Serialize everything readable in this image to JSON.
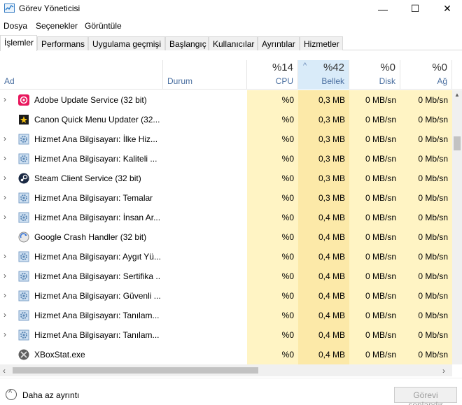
{
  "window": {
    "title": "Görev Yöneticisi",
    "minimize": "—",
    "maximize": "☐",
    "close": "✕"
  },
  "menu": [
    "Dosya",
    "Seçenekler",
    "Görüntüle"
  ],
  "tabs": [
    "İşlemler",
    "Performans",
    "Uygulama geçmişi",
    "Başlangıç",
    "Kullanıcılar",
    "Ayrıntılar",
    "Hizmetler"
  ],
  "active_tab": "İşlemler",
  "header": {
    "name": "Ad",
    "status": "Durum",
    "cpu_pct": "%14",
    "cpu": "CPU",
    "mem_pct": "%42",
    "mem": "Bellek",
    "disk_pct": "%0",
    "disk": "Disk",
    "net_pct": "%0",
    "net": "Ağ",
    "sort_indicator": "^"
  },
  "rows": [
    {
      "name": "Adobe Update Service (32 bit)",
      "cpu": "%0",
      "mem": "0,3 MB",
      "disk": "0 MB/sn",
      "net": "0 Mb/sn",
      "expandable": true,
      "icon": "adobe-icon"
    },
    {
      "name": "Canon Quick Menu Updater (32...",
      "cpu": "%0",
      "mem": "0,3 MB",
      "disk": "0 MB/sn",
      "net": "0 Mb/sn",
      "expandable": false,
      "icon": "canon-icon"
    },
    {
      "name": "Hizmet Ana Bilgisayarı: İlke Hiz...",
      "cpu": "%0",
      "mem": "0,3 MB",
      "disk": "0 MB/sn",
      "net": "0 Mb/sn",
      "expandable": true,
      "icon": "gear-icon"
    },
    {
      "name": "Hizmet Ana Bilgisayarı: Kaliteli ...",
      "cpu": "%0",
      "mem": "0,3 MB",
      "disk": "0 MB/sn",
      "net": "0 Mb/sn",
      "expandable": true,
      "icon": "gear-icon"
    },
    {
      "name": "Steam Client Service (32 bit)",
      "cpu": "%0",
      "mem": "0,3 MB",
      "disk": "0 MB/sn",
      "net": "0 Mb/sn",
      "expandable": true,
      "icon": "steam-icon"
    },
    {
      "name": "Hizmet Ana Bilgisayarı: Temalar",
      "cpu": "%0",
      "mem": "0,3 MB",
      "disk": "0 MB/sn",
      "net": "0 Mb/sn",
      "expandable": true,
      "icon": "gear-icon"
    },
    {
      "name": "Hizmet Ana Bilgisayarı: İnsan Ar...",
      "cpu": "%0",
      "mem": "0,4 MB",
      "disk": "0 MB/sn",
      "net": "0 Mb/sn",
      "expandable": true,
      "icon": "gear-icon"
    },
    {
      "name": "Google Crash Handler (32 bit)",
      "cpu": "%0",
      "mem": "0,4 MB",
      "disk": "0 MB/sn",
      "net": "0 Mb/sn",
      "expandable": false,
      "icon": "google-update-icon"
    },
    {
      "name": "Hizmet Ana Bilgisayarı: Aygıt Yü...",
      "cpu": "%0",
      "mem": "0,4 MB",
      "disk": "0 MB/sn",
      "net": "0 Mb/sn",
      "expandable": true,
      "icon": "gear-icon"
    },
    {
      "name": "Hizmet Ana Bilgisayarı: Sertifika ...",
      "cpu": "%0",
      "mem": "0,4 MB",
      "disk": "0 MB/sn",
      "net": "0 Mb/sn",
      "expandable": true,
      "icon": "gear-icon"
    },
    {
      "name": "Hizmet Ana Bilgisayarı: Güvenli ...",
      "cpu": "%0",
      "mem": "0,4 MB",
      "disk": "0 MB/sn",
      "net": "0 Mb/sn",
      "expandable": true,
      "icon": "gear-icon"
    },
    {
      "name": "Hizmet Ana Bilgisayarı: Tanılam...",
      "cpu": "%0",
      "mem": "0,4 MB",
      "disk": "0 MB/sn",
      "net": "0 Mb/sn",
      "expandable": true,
      "icon": "gear-icon"
    },
    {
      "name": "Hizmet Ana Bilgisayarı: Tanılam...",
      "cpu": "%0",
      "mem": "0,4 MB",
      "disk": "0 MB/sn",
      "net": "0 Mb/sn",
      "expandable": true,
      "icon": "gear-icon"
    },
    {
      "name": "XBoxStat.exe",
      "cpu": "%0",
      "mem": "0,4 MB",
      "disk": "0 MB/sn",
      "net": "0 Mb/sn",
      "expandable": false,
      "icon": "xbox-icon"
    }
  ],
  "footer": {
    "fewer_details": "Daha az ayrıntı",
    "end_task": "Görevi sonlandır"
  },
  "colors": {
    "cpu_bg": "#fff4c4",
    "mem_bg": "#fce9a8",
    "header_sort_bg": "#d9ebf9",
    "header_label": "#4a6fa0"
  }
}
